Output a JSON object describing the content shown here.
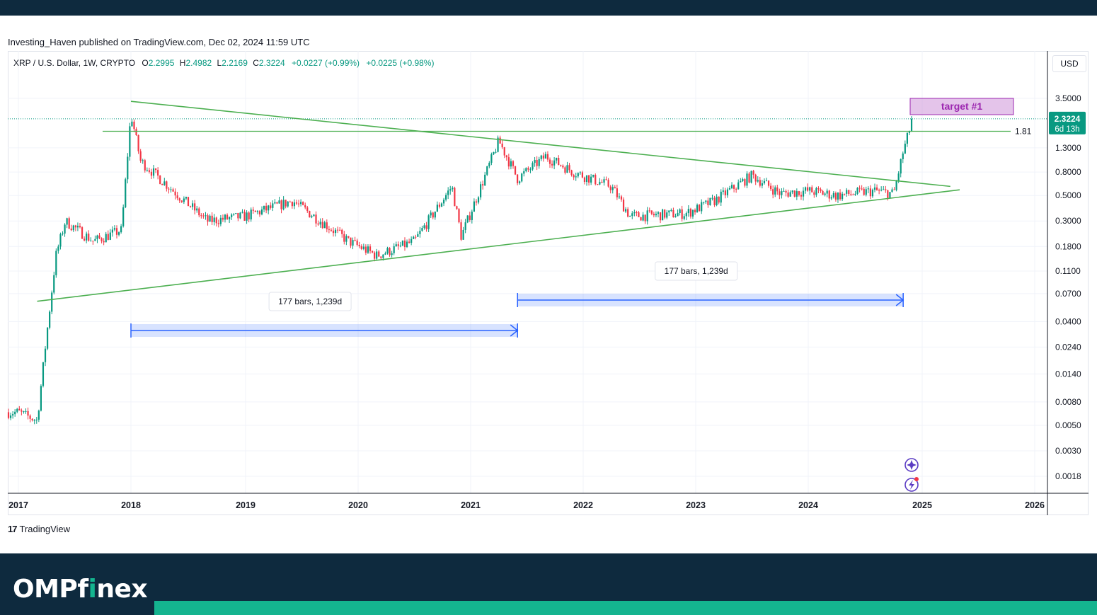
{
  "header": {
    "published": "Investing_Haven published on TradingView.com, Dec 02, 2024 11:59 UTC"
  },
  "legend": {
    "symbol": "XRP / U.S. Dollar, 1W, CRYPTO",
    "o_label": "O",
    "o_value": "2.2995",
    "h_label": "H",
    "h_value": "2.4982",
    "l_label": "L",
    "l_value": "2.2169",
    "c_label": "C",
    "c_value": "2.3224",
    "change1": "+0.0227 (+0.99%)",
    "change2": "+0.0225 (+0.98%)"
  },
  "currency": "USD",
  "price_tag": {
    "price": "2.3224",
    "countdown": "6d 13h"
  },
  "attribution": "TradingView",
  "brand": {
    "name_a": "OMPf",
    "name_i": "i",
    "name_b": "nex"
  },
  "colors": {
    "up": "#089981",
    "down": "#f23645",
    "trendline": "#4caf50",
    "measure": "#2962ff",
    "target": "#9c27b0",
    "footer_bg": "#0e2a3e",
    "footer_accent": "#14b48f"
  },
  "chart_data": {
    "type": "candlestick",
    "scale": "log",
    "x_axis_years": [
      "2017",
      "2018",
      "2019",
      "2020",
      "2021",
      "2022",
      "2023",
      "2024",
      "2025",
      "2026"
    ],
    "y_ticks": [
      "3.5000",
      "1.3000",
      "0.8000",
      "0.5000",
      "0.3000",
      "0.1800",
      "0.1100",
      "0.0700",
      "0.0400",
      "0.0240",
      "0.0140",
      "0.0080",
      "0.0050",
      "0.0030",
      "0.0018"
    ],
    "y_tick_values": [
      3.5,
      1.3,
      0.8,
      0.5,
      0.3,
      0.18,
      0.11,
      0.07,
      0.04,
      0.024,
      0.014,
      0.008,
      0.005,
      0.003,
      0.0018
    ],
    "last_price": 2.3224,
    "approx_close_path": [
      {
        "date": "2017-01",
        "value": 0.0065
      },
      {
        "date": "2017-03",
        "value": 0.0055
      },
      {
        "date": "2017-04",
        "value": 0.03
      },
      {
        "date": "2017-05",
        "value": 0.15
      },
      {
        "date": "2017-06",
        "value": 0.3
      },
      {
        "date": "2017-09",
        "value": 0.2
      },
      {
        "date": "2017-12",
        "value": 0.25
      },
      {
        "date": "2018-01",
        "value": 2.6
      },
      {
        "date": "2018-02",
        "value": 1.0
      },
      {
        "date": "2018-06",
        "value": 0.5
      },
      {
        "date": "2018-09",
        "value": 0.3
      },
      {
        "date": "2019-01",
        "value": 0.33
      },
      {
        "date": "2019-06",
        "value": 0.45
      },
      {
        "date": "2019-12",
        "value": 0.2
      },
      {
        "date": "2020-03",
        "value": 0.15
      },
      {
        "date": "2020-07",
        "value": 0.2
      },
      {
        "date": "2020-11",
        "value": 0.6
      },
      {
        "date": "2020-12",
        "value": 0.22
      },
      {
        "date": "2021-04",
        "value": 1.5
      },
      {
        "date": "2021-06",
        "value": 0.7
      },
      {
        "date": "2021-09",
        "value": 1.1
      },
      {
        "date": "2021-12",
        "value": 0.8
      },
      {
        "date": "2022-04",
        "value": 0.6
      },
      {
        "date": "2022-06",
        "value": 0.33
      },
      {
        "date": "2022-12",
        "value": 0.35
      },
      {
        "date": "2023-03",
        "value": 0.45
      },
      {
        "date": "2023-07",
        "value": 0.75
      },
      {
        "date": "2023-10",
        "value": 0.52
      },
      {
        "date": "2024-01",
        "value": 0.55
      },
      {
        "date": "2024-04",
        "value": 0.5
      },
      {
        "date": "2024-08",
        "value": 0.55
      },
      {
        "date": "2024-10",
        "value": 0.52
      },
      {
        "date": "2024-11",
        "value": 1.2
      },
      {
        "date": "2024-12",
        "value": 2.3224
      }
    ],
    "horizontal_level": {
      "value": 1.81,
      "label": "1.81"
    },
    "upper_trendline": [
      {
        "date": "2018-01",
        "value": 3.3
      },
      {
        "date": "2025-04",
        "value": 0.6
      }
    ],
    "lower_trendline": [
      {
        "date": "2017-03",
        "value": 0.06
      },
      {
        "date": "2025-05",
        "value": 0.56
      }
    ],
    "date_ranges": [
      {
        "label": "177 bars, 1,239d",
        "start": "2018-01",
        "end": "2021-06"
      },
      {
        "label": "177 bars, 1,239d",
        "start": "2021-06",
        "end": "2024-11"
      }
    ],
    "annotations": [
      {
        "label": "target #1"
      }
    ]
  }
}
